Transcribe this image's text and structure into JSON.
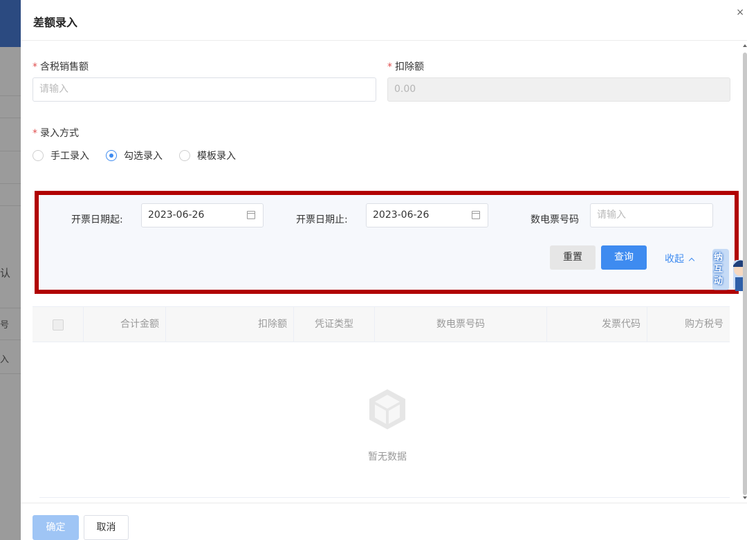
{
  "background": {
    "side_chars": [
      "认",
      "号",
      "入"
    ]
  },
  "dialog": {
    "title": "差额录入",
    "close_glyph": "×"
  },
  "form": {
    "required_mark": "*",
    "tax_sales_label": "含税销售额",
    "tax_sales_placeholder": "请输入",
    "deduction_label": "扣除额",
    "deduction_value": "0.00",
    "entry_method_label": "录入方式",
    "entry_methods": [
      {
        "label": "手工录入",
        "selected": false
      },
      {
        "label": "勾选录入",
        "selected": true
      },
      {
        "label": "模板录入",
        "selected": false
      }
    ]
  },
  "query": {
    "start_date_label": "开票日期起:",
    "start_date_value": "2023-06-26",
    "end_date_label": "开票日期止:",
    "end_date_value": "2023-06-26",
    "invoice_no_label": "数电票号码",
    "invoice_no_placeholder": "请输入",
    "reset_label": "重置",
    "search_label": "查询",
    "collapse_label": "收起"
  },
  "mascot": {
    "text": [
      "纳",
      "互",
      "动"
    ]
  },
  "table": {
    "columns": [
      "合计金额",
      "扣除额",
      "凭证类型",
      "数电票号码",
      "发票代码",
      "购方税号"
    ],
    "empty_text": "暂无数据"
  },
  "footer": {
    "confirm_label": "确定",
    "cancel_label": "取消"
  },
  "colors": {
    "primary": "#3e8bf0",
    "highlight_border": "#b00000",
    "required": "#e05050"
  }
}
